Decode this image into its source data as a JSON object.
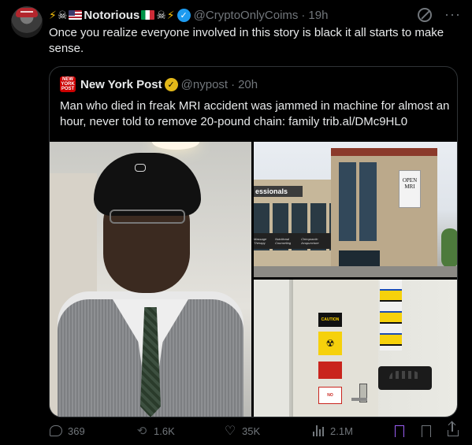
{
  "tweet": {
    "author_name": "Notorious",
    "author_handle": "@CryptoOnlyCoims",
    "time": "19h",
    "text": "Once you realize everyone involved in this story is black it all starts to make sense."
  },
  "quote": {
    "author_name": "New York Post",
    "author_handle": "@nypost",
    "time": "20h",
    "logo_text": "NEW YORK POST",
    "text": "Man who died in freak MRI accident was jammed in machine for almost an hour, never told to remove 20-pound chain: family trib.al/DMc9HL0",
    "media": {
      "building_sign": "essionals",
      "mri_sign_line1": "OPEN",
      "mri_sign_line2": "MRI",
      "storefront_labels": [
        "Massage Therapy",
        "Nutritional Counseling",
        "Chiropractic Acupuncture"
      ],
      "door_sign_caution": "CAUTION",
      "door_sign_no": "NO"
    }
  },
  "actions": {
    "replies": "369",
    "retweets": "1.6K",
    "likes": "35K",
    "views": "2.1M"
  },
  "colors": {
    "background": "#000000",
    "text": "#e7e9ea",
    "muted": "#71767b",
    "verified_blue": "#1d9bf0",
    "verified_gold": "#e2b719",
    "nyp_red": "#cc0000"
  }
}
